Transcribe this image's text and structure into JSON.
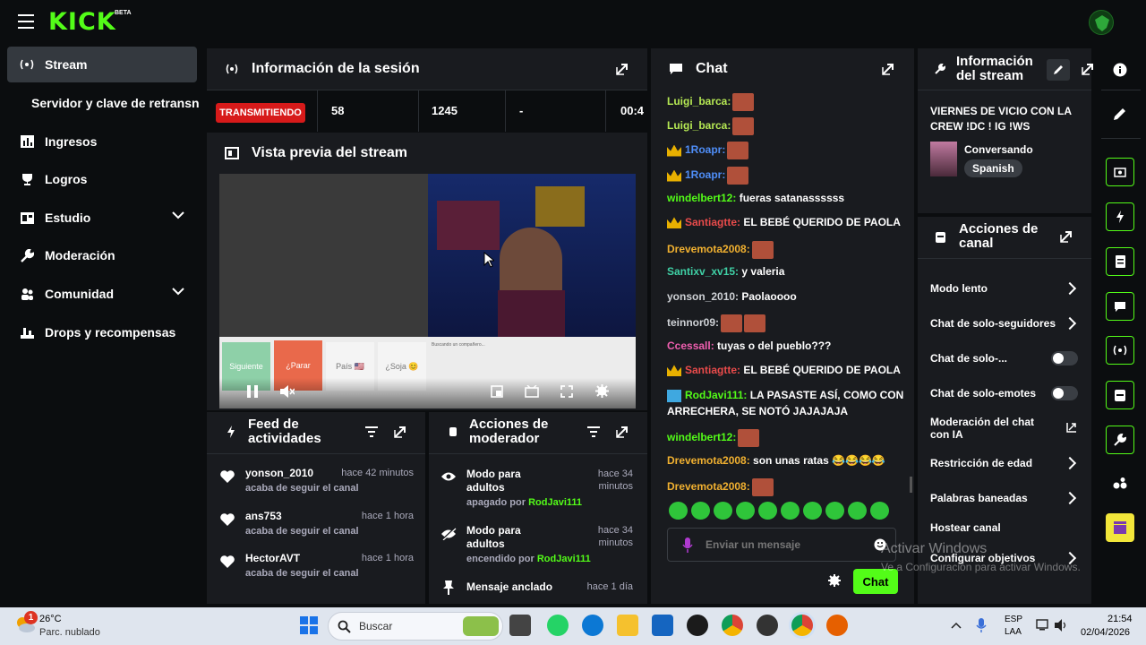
{
  "topbar": {
    "logo": "KICK",
    "beta": "BETA"
  },
  "sidebar": {
    "items": [
      {
        "label": "Stream"
      },
      {
        "label": "Servidor y clave de retransn"
      },
      {
        "label": "Ingresos"
      },
      {
        "label": "Logros"
      },
      {
        "label": "Estudio"
      },
      {
        "label": "Moderación"
      },
      {
        "label": "Comunidad"
      },
      {
        "label": "Drops y recompensas"
      }
    ]
  },
  "session": {
    "title": "Información de la sesión",
    "status": "TRANSMITIENDO",
    "stat1": "58",
    "stat2": "1245",
    "stat3": "-",
    "stat4": "00:4"
  },
  "preview": {
    "title": "Vista previa del stream",
    "buttons": [
      "Siguiente",
      "¿Parar",
      "País 🇺🇸",
      "¿Soja 😊"
    ],
    "search_text": "Buscando un compañero..."
  },
  "feed": {
    "title1": "Feed de",
    "title2": "actividades",
    "items": [
      {
        "name": "yonson_2010",
        "time": "hace 42 minutos",
        "sub": "acaba de seguir el canal"
      },
      {
        "name": "ans753",
        "time": "hace 1 hora",
        "sub": "acaba de seguir el canal"
      },
      {
        "name": "HectorAVT",
        "time": "hace 1 hora",
        "sub": "acaba de seguir el canal"
      }
    ]
  },
  "modactions": {
    "title1": "Acciones de",
    "title2": "moderador",
    "items": [
      {
        "l1": "Modo para",
        "l2": "adultos",
        "t1": "hace 34",
        "t2": "minutos",
        "sub": "apagado por",
        "user": "RodJavi111"
      },
      {
        "l1": "Modo para",
        "l2": "adultos",
        "t1": "hace 34",
        "t2": "minutos",
        "sub": "encendido por",
        "user": "RodJavi111"
      }
    ],
    "pinned": "Mensaje anclado",
    "pinned_time": "hace 1 día"
  },
  "chat": {
    "title": "Chat",
    "messages": [
      {
        "user": "Luigi_barca:",
        "text": "",
        "color": "#b5e853"
      },
      {
        "user": "Luigi_barca:",
        "text": "",
        "color": "#b5e853"
      },
      {
        "user": "1Roapr:",
        "text": "",
        "color": "#4f8ef7"
      },
      {
        "user": "1Roapr:",
        "text": "",
        "color": "#4f8ef7"
      },
      {
        "user": "windelbert12:",
        "text": " fueras satanassssss",
        "color": "#53fc18"
      },
      {
        "user": "Santiagtte:",
        "text": " EL BEBÉ QUERIDO DE PAOLA",
        "color": "#e94b4b"
      },
      {
        "user": "Drevemota2008:",
        "text": "",
        "color": "#f0b030"
      },
      {
        "user": "Santixv_xv15:",
        "text": " y valeria",
        "color": "#3fd0a5"
      },
      {
        "user": "yonson_2010:",
        "text": " Paolaoooo",
        "color": "#cfd2d6"
      },
      {
        "user": "teinnor09:",
        "text": "",
        "color": "#cfd2d6"
      },
      {
        "user": "Ccessall:",
        "text": " tuyas o del pueblo???",
        "color": "#f05fb0"
      },
      {
        "user": "Santiagtte:",
        "text": " EL BEBÉ QUERIDO DE PAOLA",
        "color": "#e94b4b"
      },
      {
        "user": "RodJavi111:",
        "text": " LA PASASTE ASÍ, COMO CON",
        "color": "#53fc18"
      },
      {
        "user": "",
        "text": "ARRECHERA, SE NOTÓ JAJAJAJA",
        "color": "#fff"
      },
      {
        "user": "windelbert12:",
        "text": "",
        "color": "#53fc18"
      },
      {
        "user": "Drevemota2008:",
        "text": " son unas ratas 😂😂😂😂",
        "color": "#f0b030"
      },
      {
        "user": "Drevemota2008:",
        "text": "",
        "color": "#f0b030"
      }
    ],
    "placeholder": "Enviar un mensaje",
    "send": "Chat"
  },
  "streaminfo": {
    "title1": "Información",
    "title2": "del stream",
    "stream_title1": "VIERNES DE VICIO CON LA",
    "stream_title2": "CREW !DC ! IG !WS",
    "category": "Conversando",
    "language": "Spanish"
  },
  "channel": {
    "title1": "Acciones de",
    "title2": "canal",
    "items": [
      "Modo lento",
      "Chat de solo-seguidores",
      "Chat de solo-...",
      "Chat de solo-emotes",
      "Moderación del chat",
      "con IA",
      "Restricción de edad",
      "Palabras baneadas",
      "Hostear canal",
      "Configurar objetivos"
    ]
  },
  "watermark": {
    "l1": "Activar Windows",
    "l2": "Ve a Configuración para activar Windows."
  },
  "taskbar": {
    "temp": "26°C",
    "weather": "Parc. nublado",
    "badge": "1",
    "search": "Buscar",
    "lang1": "ESP",
    "lang2": "LAA",
    "time": "21:54",
    "date": "02/04/2026"
  },
  "colors": {
    "accent": "#53fc18",
    "live": "#d71a1a"
  }
}
